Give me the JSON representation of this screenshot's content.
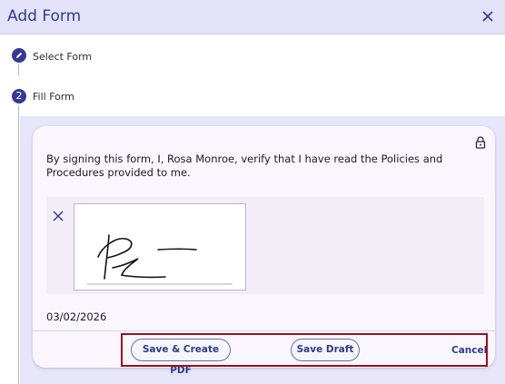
{
  "header": {
    "title": "Add Form",
    "close_icon": "close-icon"
  },
  "steps": [
    {
      "marker_icon": "pencil-icon",
      "label": "Select Form"
    },
    {
      "number": "2",
      "label": "Fill Form"
    }
  ],
  "form": {
    "statement": "By signing this form, I, Rosa Monroe, verify that I have read the Policies and Procedures provided to me.",
    "lock_icon": "lock-icon",
    "signature_clear_icon": "close-icon",
    "date": "03/02/2026"
  },
  "actions": {
    "save_pdf_label": "Save & Create PDF",
    "save_draft_label": "Save Draft",
    "cancel_label": "Cancel"
  },
  "colors": {
    "accent": "#34399b",
    "header_bg": "#e4e2f8",
    "highlight": "#a20d1a"
  }
}
